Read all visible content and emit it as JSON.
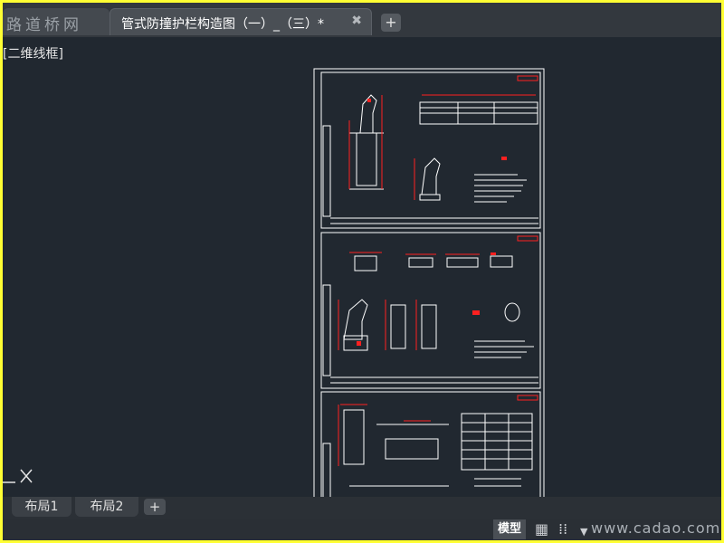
{
  "tabs": {
    "watermark_text": "路道桥网",
    "active_label": "管式防撞护栏构造图（一）_（三）*",
    "close_glyph": "✖",
    "add_glyph": "+"
  },
  "viewport": {
    "label": "[二维线框]"
  },
  "layout_tabs": {
    "tab1": "布局1",
    "tab2": "布局2",
    "add_glyph": "+"
  },
  "status": {
    "model_label": "模型",
    "watermark": "www.cadao.com",
    "icons": [
      "grid-icon",
      "snap-icon",
      "dropdown-icon",
      "ortho-icon",
      "polar-icon",
      "osnap-icon"
    ]
  },
  "colors": {
    "canvas": "#212830",
    "tabbar": "#33383e",
    "drawing_lines": "#ffffff",
    "drawing_dims": "#ff2020",
    "frame_border": "#ffff33"
  }
}
